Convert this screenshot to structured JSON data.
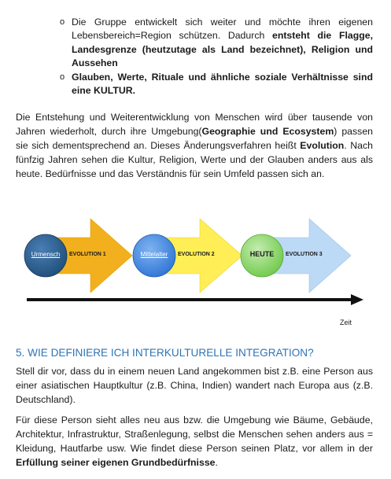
{
  "bullets": [
    {
      "parts": [
        {
          "text": "Die Gruppe entwickelt sich weiter und möchte ihren eigenen Lebensbereich=Region schützen. Dadurch ",
          "bold": false
        },
        {
          "text": "entsteht die Flagge, Landesgrenze (heutzutage als Land bezeichnet), Religion und Aussehen",
          "bold": true
        }
      ]
    },
    {
      "parts": [
        {
          "text": "Glauben, Werte, Rituale und ähnliche soziale Verhältnisse sind eine KULTUR.",
          "bold": true
        }
      ]
    }
  ],
  "bullet_marker": "o",
  "paragraph_1": {
    "parts": [
      {
        "text": "Die Entstehung und Weiterentwicklung von Menschen wird über tausende von Jahren wiederholt, durch ihre Umgebung(",
        "bold": false
      },
      {
        "text": "Geographie und Ecosystem",
        "bold": true
      },
      {
        "text": ") passen sie sich dementsprechend an. Dieses Änderungsverfahren heißt ",
        "bold": false
      },
      {
        "text": "Evolution",
        "bold": true
      },
      {
        "text": ". Nach fünfzig Jahren sehen die Kultur, Religion, Werte und der Glauben anders aus als heute. Bedürfnisse und das Verständnis für sein Umfeld passen sich an.",
        "bold": false
      }
    ]
  },
  "diagram": {
    "stages": [
      {
        "circle_label": "Urmensch",
        "evolution_label": "EVOLUTION 1",
        "circle_color": "#1f4e79",
        "arrow_color": "#f2b01e"
      },
      {
        "circle_label": "Mittelalter",
        "evolution_label": "EVOLUTION 2",
        "circle_color": "#2e75d6",
        "arrow_color": "#ffee55"
      },
      {
        "circle_label": "HEUTE",
        "evolution_label": "EVOLUTION 3",
        "circle_color": "#70c94a",
        "arrow_color": "#bcd9f5"
      }
    ],
    "axis_label": "Zeit"
  },
  "heading": "5. WIE DEFINIERE ICH INTERKULTURELLE INTEGRATION?",
  "paragraph_2": "Stell dir vor, dass du in einem neuen Land angekommen bist z.B. eine Person aus einer asiatischen Hauptkultur (z.B. China, Indien) wandert nach Europa aus (z.B. Deutschland).",
  "paragraph_3": {
    "parts": [
      {
        "text": "Für diese Person sieht alles neu aus bzw. die Umgebung wie Bäume, Gebäude, Architektur, Infrastruktur, Straßenlegung, selbst die Menschen sehen anders aus = Kleidung, Hautfarbe usw. Wie findet diese Person seinen Platz, vor allem in der ",
        "bold": false
      },
      {
        "text": "Erfüllung seiner eigenen Grundbedürfnisse",
        "bold": true
      },
      {
        "text": ".",
        "bold": false
      }
    ]
  }
}
